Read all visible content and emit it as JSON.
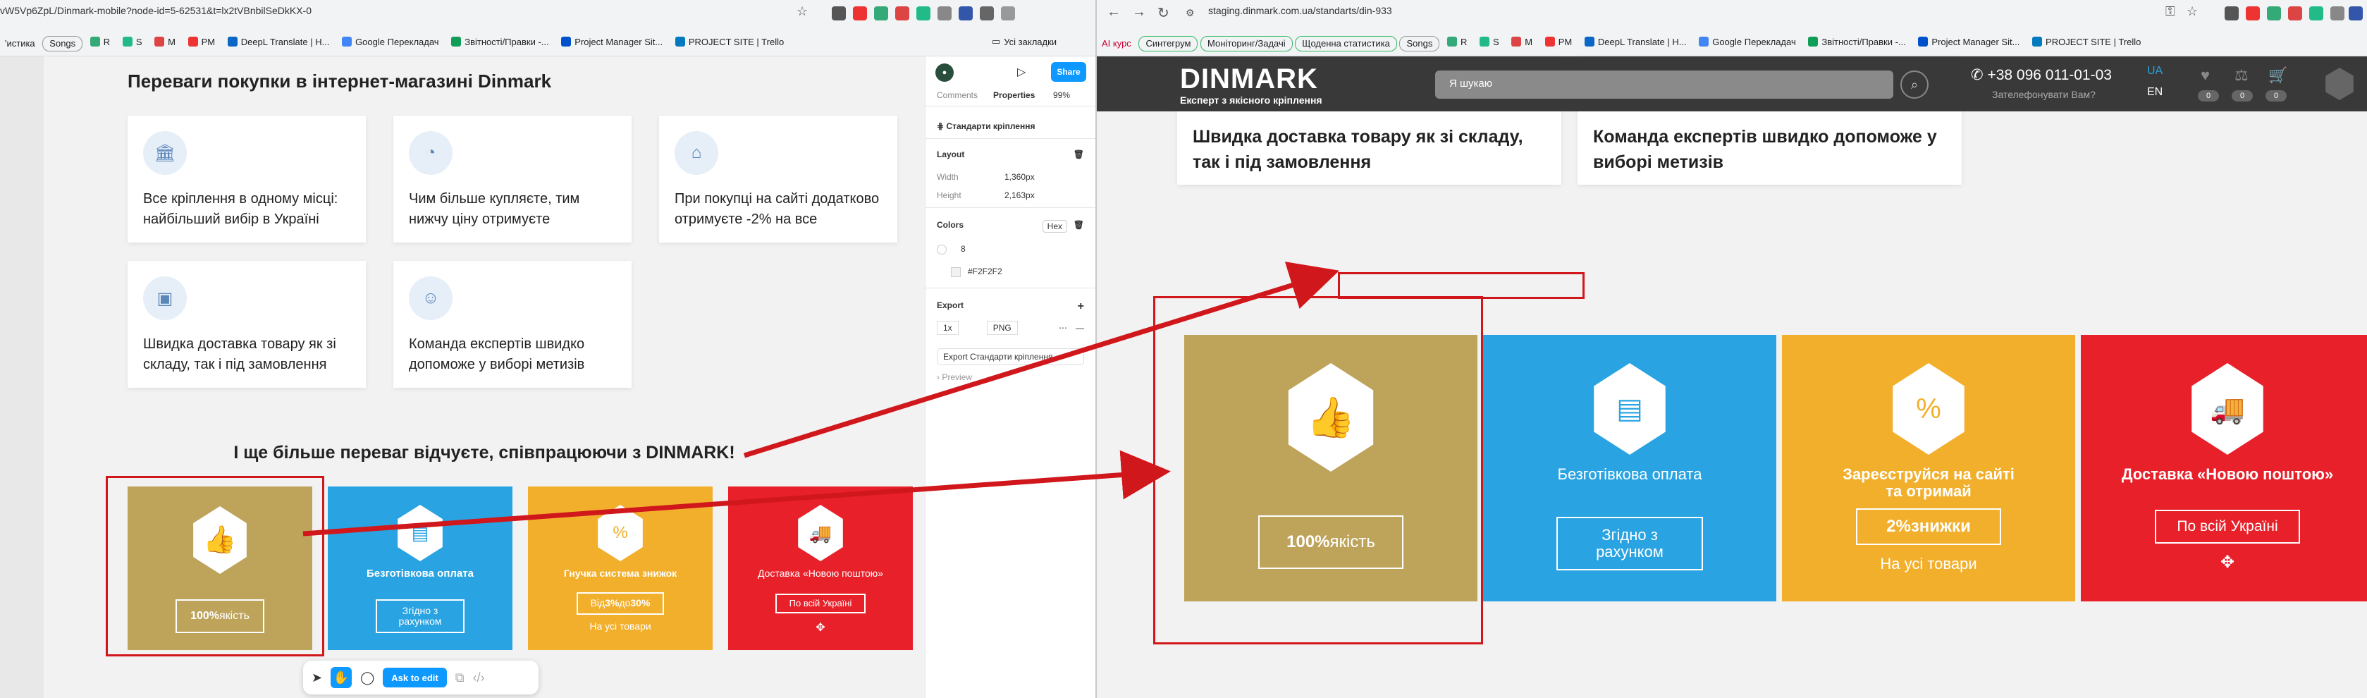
{
  "left_browser": {
    "url": "vW5Vp6ZpL/Dinmark-mobile?node-id=5-62531&t=lx2tVBnbilSeDkKX-0",
    "bookmarks": [
      "'истика",
      "Songs",
      "R",
      "S",
      "M",
      "PM",
      "DeepL Translate | H...",
      "Google Перекладач",
      "Звітності/Правки -...",
      "Project Manager Sit...",
      "PROJECT SITE | Trello"
    ],
    "all_bookmarks": "Усі закладки"
  },
  "figma": {
    "frame_title": "Переваги покупки в інтернет-магазині Dinmark",
    "cards": [
      {
        "icon": "bank-icon",
        "text": "Все кріплення в одному місці: найбільший вибір в Україні"
      },
      {
        "icon": "percent-icon",
        "text": "Чим більше купляєте, тим нижчу ціну отримуєте"
      },
      {
        "icon": "tag-icon",
        "text": "При покупці на сайті додатково отримуєте -2% на все"
      },
      {
        "icon": "truck-icon",
        "text": "Швидка доставка товару як зі складу, так і під замовлення"
      },
      {
        "icon": "team-icon",
        "text": "Команда експертів швидко допоможе у виборі метизів"
      }
    ],
    "subtitle": "І ще більше переваг відчуєте, співпрацюючи з DINMARK!",
    "tiles": [
      {
        "title": "",
        "button_strong": "100%",
        "button_rest": " якість",
        "sub": ""
      },
      {
        "title": "Безготівкова оплата",
        "button": "Згідно з рахунком",
        "sub": ""
      },
      {
        "title": "Гнучка система знижок",
        "button_prefix": "Від ",
        "button_strong1": "3%",
        "button_mid": " до ",
        "button_strong2": "30%",
        "sub": "На усі товари"
      },
      {
        "title": "Доставка «Новою поштою»",
        "button": "По всій Україні",
        "sub": ""
      }
    ],
    "toolbar": {
      "ask_to_edit": "Ask to edit"
    },
    "help": "?"
  },
  "panel": {
    "tab_comments": "Comments",
    "tab_properties": "Properties",
    "zoom": "99%",
    "share": "Share",
    "component": "Стандарти кріплення",
    "layout_title": "Layout",
    "width_label": "Width",
    "width_value": "1,360px",
    "height_label": "Height",
    "height_value": "2,163px",
    "colors_title": "Colors",
    "color_mode": "Hex",
    "color_1": "8",
    "color_2": "#F2F2F2",
    "export_title": "Export",
    "export_scale": "1x",
    "export_format": "PNG",
    "export_button": "Export Стандарти кріплення",
    "preview": "Preview"
  },
  "right_browser": {
    "url": "staging.dinmark.com.ua/standarts/din-933",
    "bookmarks": [
      "AI курс",
      "Синтегрум",
      "Моніторинг/Задачі",
      "Щоденна статистика",
      "Songs",
      "R",
      "S",
      "M",
      "PM",
      "DeepL Translate | H...",
      "Google Перекладач",
      "Звітності/Правки -...",
      "Project Manager Sit...",
      "PROJECT SITE | Trello"
    ]
  },
  "site": {
    "logo": "DINMARK",
    "tagline": "Експерт з якісного кріплення",
    "search_placeholder": "Я шукаю",
    "phone": "+38 096 011-01-03",
    "call_question": "Зателефонувати Вам?",
    "lang_ua": "UA",
    "lang_en": "EN",
    "counts": [
      "0",
      "0",
      "0"
    ],
    "cards": [
      {
        "icon": "truck-icon",
        "text": "Швидка доставка товару як зі складу, так і під замовлення"
      },
      {
        "icon": "team-icon",
        "text": "Команда експертів швидко допоможе у виборі метизів"
      }
    ],
    "tiles": [
      {
        "button_strong": "100%",
        "button_rest": " якість"
      },
      {
        "title": "Безготівкова оплата",
        "button": "Згідно з рахунком"
      },
      {
        "title": "Зареєструйся на сайті та отримай",
        "button_strong": "2%",
        "button_rest": " знижки",
        "sub": "На усі товари"
      },
      {
        "title": "Доставка «Новою поштою»",
        "button": "По всій Україні"
      }
    ]
  },
  "colors": {
    "gold": "#bea35a",
    "blue": "#29a3e1",
    "orange": "#f2af2c",
    "red": "#e8202a",
    "annotation_red": "#d0171c"
  }
}
